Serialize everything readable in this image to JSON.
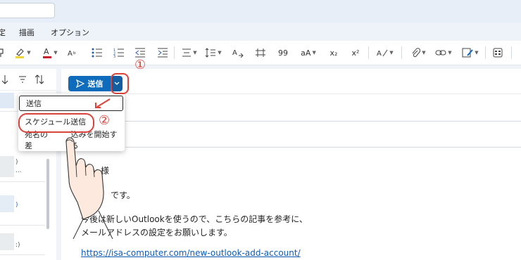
{
  "menu": {
    "items": [
      "定",
      "描画",
      "オプション"
    ]
  },
  "ribbon": {
    "icons": [
      "format-painter-icon",
      "highlight-icon",
      "font-color-icon",
      "clear-format-icon",
      "bullets-icon",
      "numbering-icon",
      "decrease-indent-icon",
      "increase-indent-icon",
      "align-icon",
      "line-spacing-icon",
      "styles-icon",
      "paragraph-icon",
      "quote-icon",
      "font-size-icon",
      "subscript-icon",
      "superscript-icon",
      "editor-icon",
      "attach-icon",
      "link-icon",
      "signature-icon",
      "apps-icon"
    ],
    "labels": {
      "quote": "99",
      "font_size": "aA",
      "subscript": "x₂",
      "superscript": "x²"
    }
  },
  "left_pane": {
    "sort_icons": [
      "arrow-down-icon",
      "filter-icon",
      "sort-icon"
    ],
    "snippets": [
      {
        "text": ")",
        "color": "#555555"
      },
      {
        "text": "...",
        "color": "#555555"
      },
      {
        "text": ")",
        "color": "#2a6ac8"
      },
      {
        "text": ")",
        "color": "#2a6ac8"
      },
      {
        "text": ":)",
        "color": "#555555"
      }
    ]
  },
  "compose": {
    "send_label": "送信",
    "greeting_fragment": "様",
    "line_intro": "です。",
    "line_1": "今後は新しいOutlookを使うので、こちらの記事を参考に、",
    "line_2": "メールアドレスの設定をお願いします。",
    "link_text": "https://isa-computer.com/new-outlook-add-account/"
  },
  "dropdown": {
    "items": [
      {
        "label": "送信"
      },
      {
        "label": "スケジュール送信"
      },
      {
        "label": "宛名の差し込みを開始する"
      }
    ],
    "visible_third_label_left": "宛名の差",
    "visible_third_label_right": "込みを開始する"
  },
  "annotations": {
    "step1": "①",
    "step2": "②",
    "accent": "#d9433a"
  },
  "colors": {
    "send_blue": "#0f6cbd",
    "link_blue": "#0f5bb5"
  }
}
